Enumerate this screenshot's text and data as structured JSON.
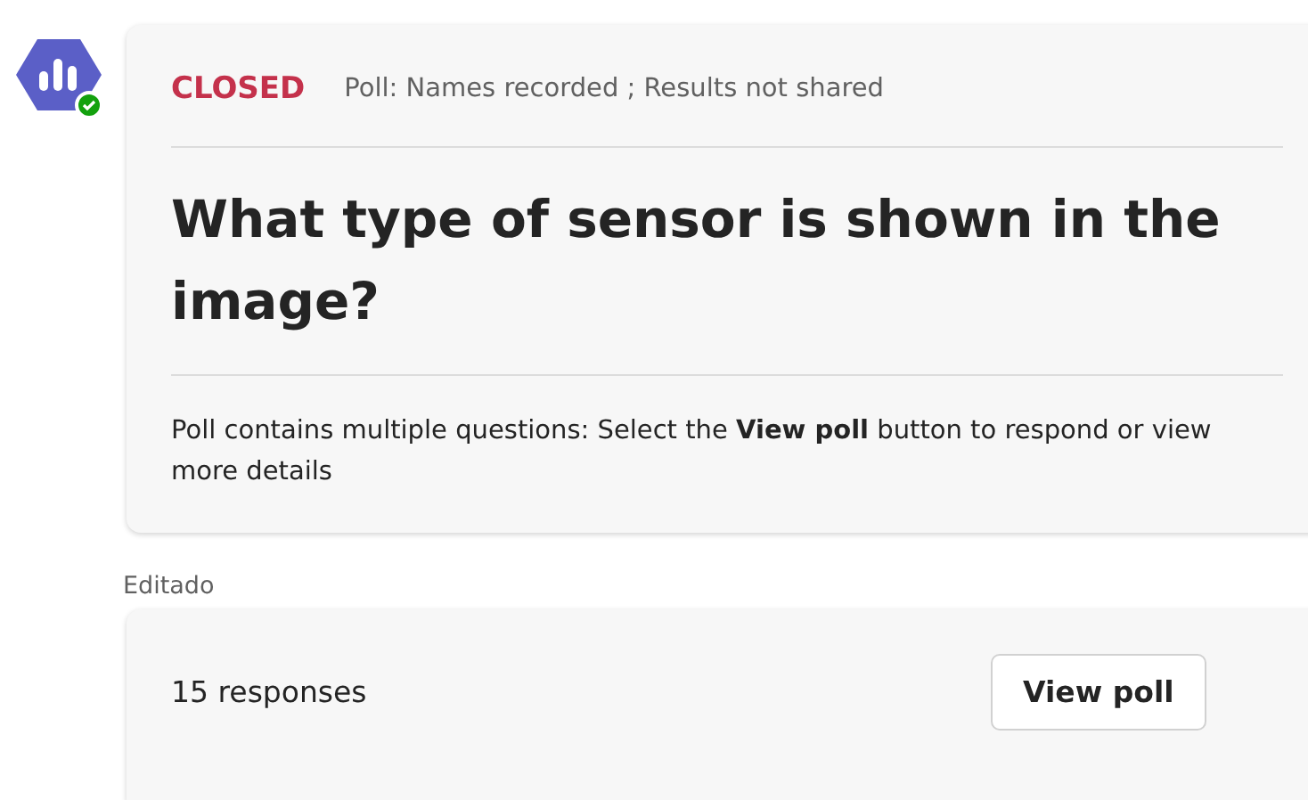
{
  "poll_card": {
    "status": {
      "label": "CLOSED",
      "kind": "closed"
    },
    "meta": "Poll: Names recorded ; Results not shared",
    "question": "What type of sensor is shown in the image?",
    "note": "Poll contains multiple questions: Select the **View poll** button to respond or view more details"
  },
  "edited_label": "Editado",
  "responses_card": {
    "count": "15 responses",
    "button": "View poll"
  }
}
